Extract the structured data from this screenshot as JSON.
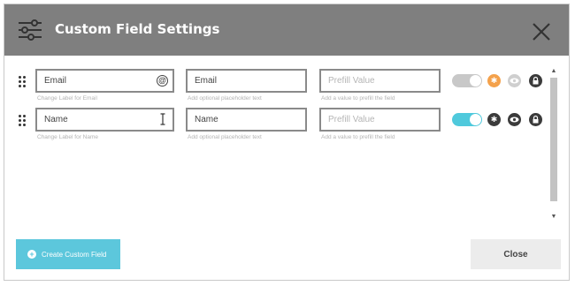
{
  "header": {
    "title": "Custom Field Settings"
  },
  "fields": [
    {
      "label_value": "Email",
      "label_hint": "Change Label for Email",
      "placeholder_value": "Email",
      "placeholder_hint": "Add optional placeholder text",
      "prefill_placeholder": "Prefill Value",
      "prefill_hint": "Add a value to prefill the field",
      "enabled": false,
      "label_icon": "at-sign-icon"
    },
    {
      "label_value": "Name",
      "label_hint": "Change Label for Name",
      "placeholder_value": "Name",
      "placeholder_hint": "Add optional placeholder text",
      "prefill_placeholder": "Prefill Value",
      "prefill_hint": "Add a value to prefill the field",
      "enabled": true,
      "label_icon": "text-cursor-icon"
    }
  ],
  "footer": {
    "create_label": "Create Custom Field",
    "close_label": "Close"
  },
  "colors": {
    "header_bg": "#7f7f7f",
    "accent": "#5cc7dc",
    "required_active": "#f4a14b",
    "dark_icon": "#3b3b3b",
    "muted_icon": "#cfcfcf"
  }
}
